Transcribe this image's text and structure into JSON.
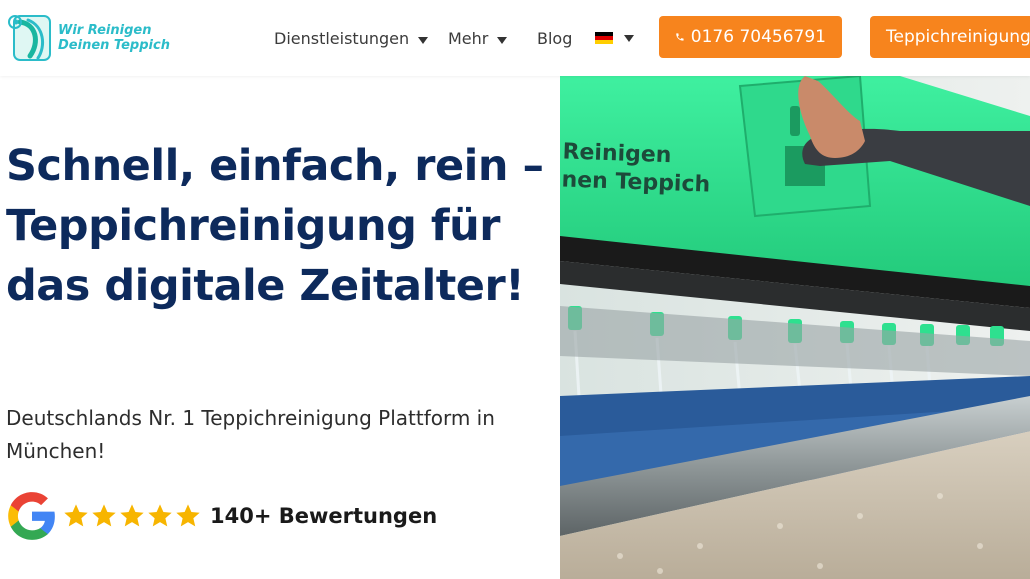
{
  "brand": {
    "logo_line1": "Wir Reinigen",
    "logo_line2": "Deinen Teppich",
    "accent_color": "#f7841d",
    "logo_color": "#2bbcc9",
    "heading_color": "#0d2a5c"
  },
  "nav": {
    "items": [
      {
        "label": "Dienstleistungen",
        "has_dropdown": true
      },
      {
        "label": "Mehr",
        "has_dropdown": true
      },
      {
        "label": "Blog",
        "has_dropdown": false
      }
    ],
    "language": {
      "flag": "german-flag-icon",
      "has_dropdown": true
    }
  },
  "header_buttons": {
    "phone_label": "0176 70456791",
    "phone_icon": "phone-icon",
    "cta_label": "Teppichreinigung"
  },
  "hero": {
    "title": "Schnell, einfach, rein – Teppichreinigung für das digitale Zeitalter!",
    "subtitle": "Deutschlands Nr. 1 Teppichreinigung Plattform in München!",
    "rating_stars": 5,
    "reviews_label": "140+ Bewertungen",
    "machine_text_line1": "Reinigen",
    "machine_text_line2": "nen Teppich"
  }
}
